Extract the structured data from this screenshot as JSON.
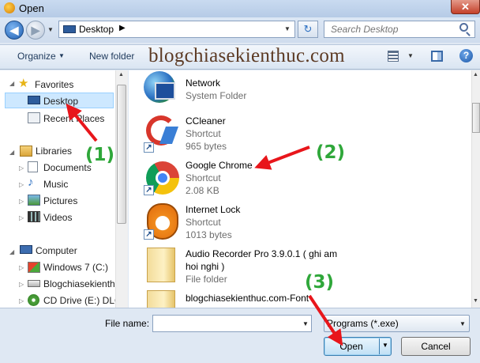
{
  "window": {
    "title": "Open",
    "close_glyph": "✕"
  },
  "address": {
    "location": "Desktop",
    "chevron": "▶",
    "back_glyph": "◀",
    "forward_glyph": "▶",
    "refresh_glyph": "↻"
  },
  "search": {
    "placeholder": "Search Desktop"
  },
  "toolbar": {
    "organize_label": "Organize",
    "newfolder_label": "New folder",
    "help_glyph": "?"
  },
  "watermark": "blogchiasekienthuc.com",
  "nav": {
    "favorites": "Favorites",
    "desktop": "Desktop",
    "recent_places": "Recent Places",
    "libraries": "Libraries",
    "documents": "Documents",
    "music": "Music",
    "pictures": "Pictures",
    "videos": "Videos",
    "computer": "Computer",
    "drive_c": "Windows 7 (C:)",
    "drive_d": "Blogchiasekienth",
    "drive_e": "CD Drive (E:) DLC"
  },
  "files": [
    {
      "name": "Network",
      "line2": "System Folder",
      "line3": ""
    },
    {
      "name": "CCleaner",
      "line2": "Shortcut",
      "line3": "965 bytes"
    },
    {
      "name": "Google Chrome",
      "line2": "Shortcut",
      "line3": "2.08 KB"
    },
    {
      "name": "Internet Lock",
      "line2": "Shortcut",
      "line3": "1013 bytes"
    },
    {
      "name": "Audio Recorder Pro 3.9.0.1 ( ghi am",
      "line2": "hoi nghi )",
      "line3": "File folder"
    },
    {
      "name": "blogchiasekienthuc.com-Font",
      "line2": "",
      "line3": ""
    }
  ],
  "bottom": {
    "filename_label": "File name:",
    "filename_value": "",
    "filetype_value": "Programs (*.exe)",
    "open_label": "Open",
    "cancel_label": "Cancel"
  },
  "annotations": {
    "step1": "(1)",
    "step2": "(2)",
    "step3": "(3)"
  },
  "colors": {
    "annotation_text": "#2fa73a",
    "arrow": "#e8161b",
    "selection": "#cde8ff"
  }
}
